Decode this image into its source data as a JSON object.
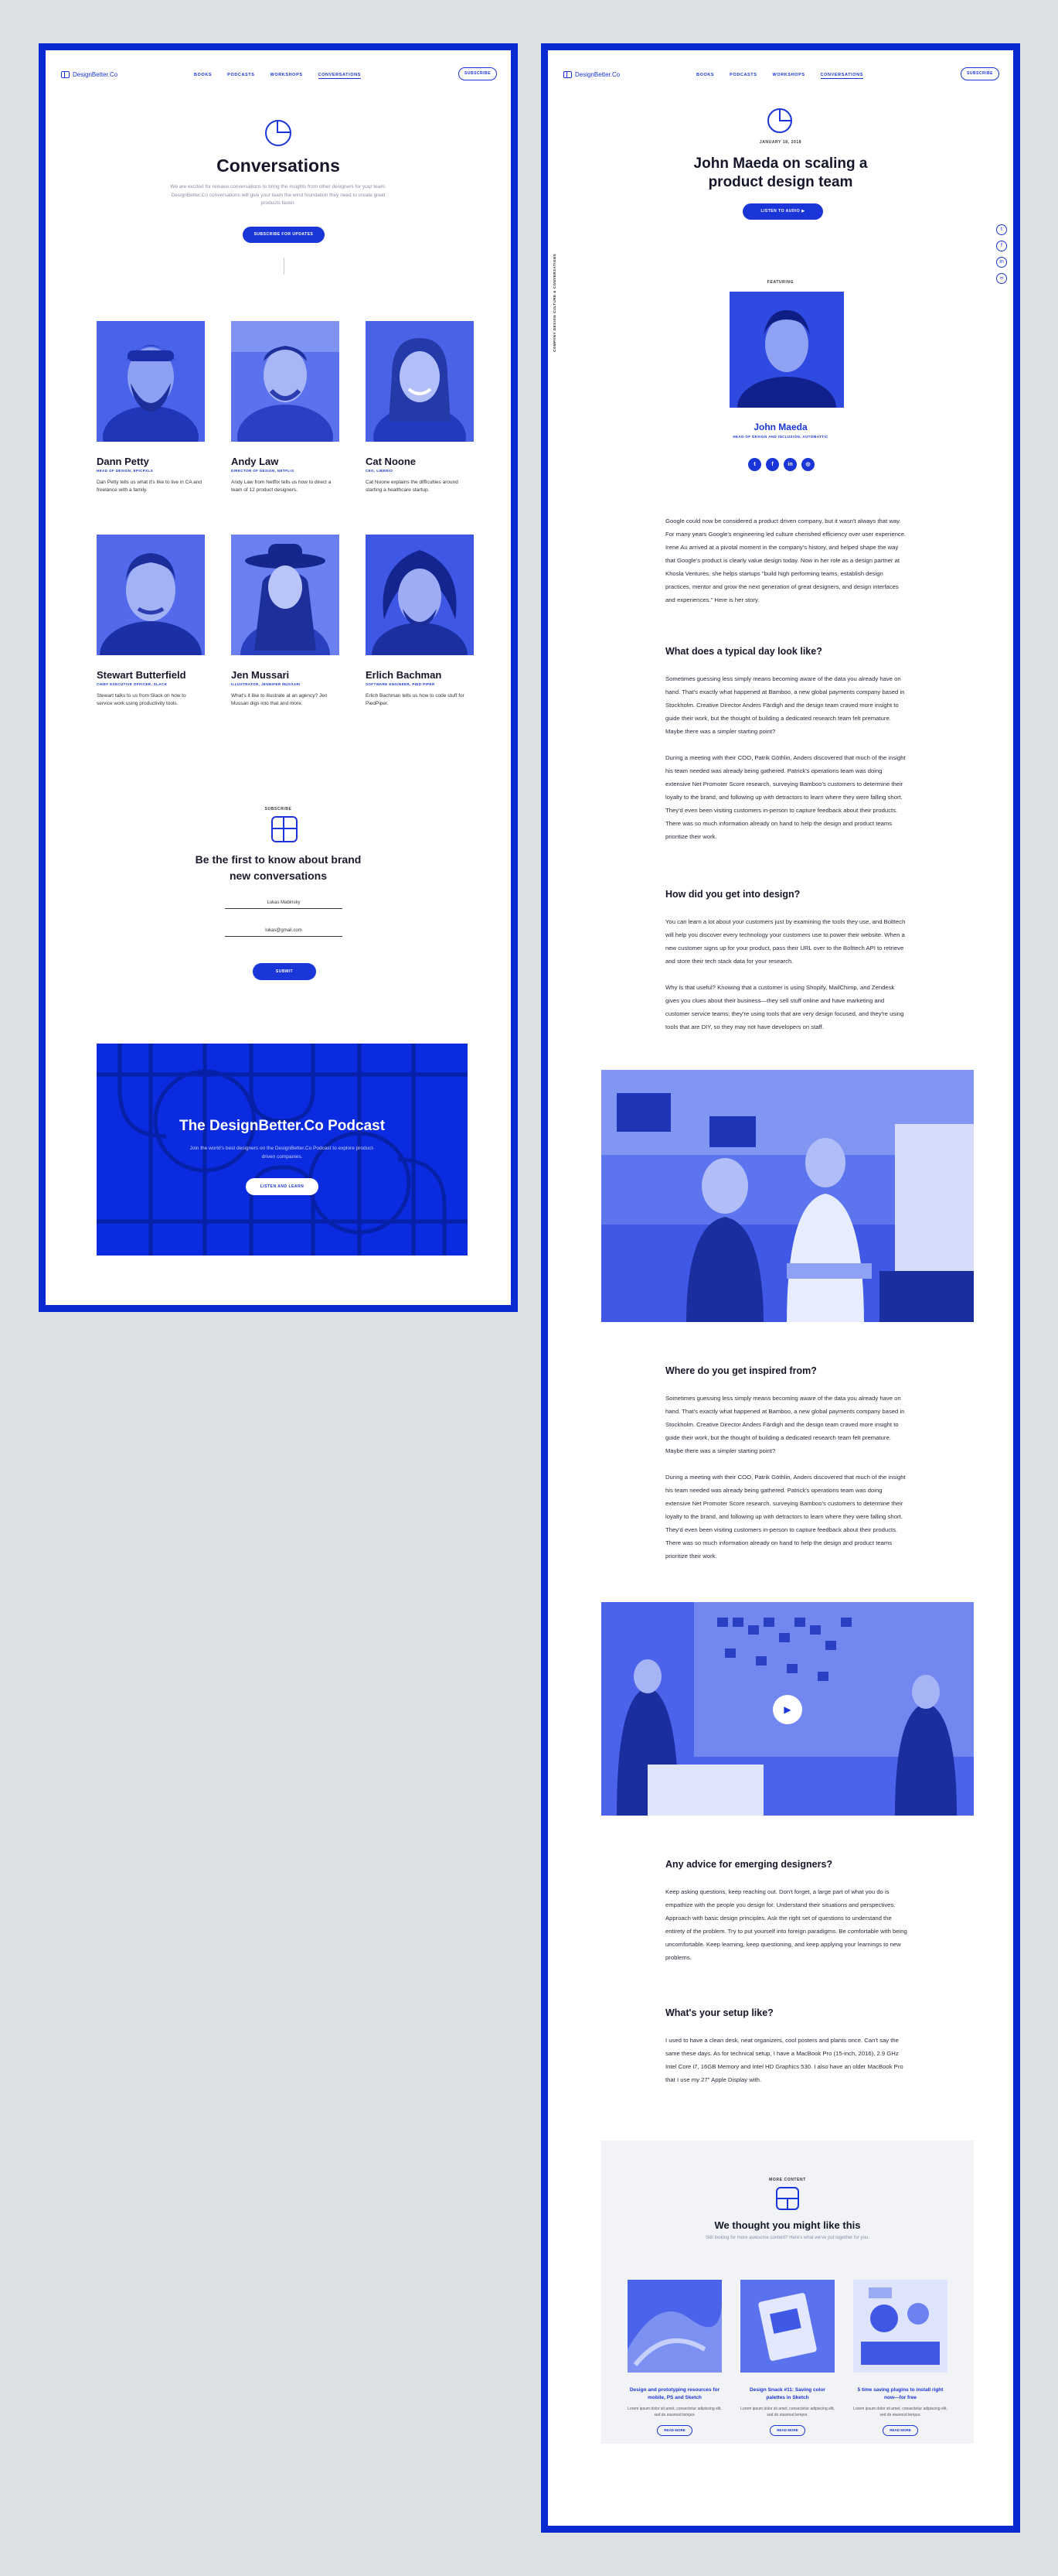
{
  "nav": {
    "logo": "DesignBetter.Co",
    "links": [
      "BOOKS",
      "PODCASTS",
      "WORKSHOPS",
      "CONVERSATIONS"
    ],
    "subscribe": "SUBSCRIBE"
  },
  "conversations": {
    "title": "Conversations",
    "intro": "We are excited for release conversations to bring the insights from other designers for your team. DesignBetter.Co conversations will give your team the wind foundation they need to create great products faster.",
    "cta": "SUBSCRIBE FOR UPDATES",
    "people": [
      {
        "name": "Dann Petty",
        "role": "HEAD OF DESIGN, EPICPXLS",
        "desc": "Dan Petty tells us what it's like to live in CA and freelance with a family."
      },
      {
        "name": "Andy Law",
        "role": "DIRECTOR OF DESIGN, NETFLIX",
        "desc": "Andy Law from Netflix tells us how to direct a team of 12 product designers."
      },
      {
        "name": "Cat Noone",
        "role": "CEO, LIBERIO",
        "desc": "Cat Noone explains the difficulties around starting a healthcare startup."
      },
      {
        "name": "Stewart Butterfield",
        "role": "CHIEF EXECUTIVE OFFICER, SLACK",
        "desc": "Stewart talks to us from Slack on how to service work using productivity tools."
      },
      {
        "name": "Jen Mussari",
        "role": "ILLUSTRATOR, JENNIFER MUSSARI",
        "desc": "What's it like to illustrate at an agency? Jen Mussari digs into that and more."
      },
      {
        "name": "Erlich Bachman",
        "role": "SOFTWARE ENGINEER, PIED PIPER",
        "desc": "Erlich Bachman tells us how to code stuff for PiedPiper."
      }
    ],
    "newsletter": {
      "label": "SUBSCRIBE",
      "title_line1": "Be the first to know about brand",
      "title_line2": "new conversations",
      "name_value": "Lukas Mabinsky",
      "email_value": "lukas@gmail.com",
      "submit": "SUBMIT"
    },
    "podcast": {
      "title": "The DesignBetter.Co Podcast",
      "desc": "Join the world's best designers on the DesignBetter.Co Podcast to explore product-driven companies.",
      "button": "LISTEN AND LEARN"
    }
  },
  "article": {
    "date": "JANUARY 18, 2018",
    "title_line1": "John Maeda on scaling a",
    "title_line2": "product design team",
    "listen": "LISTEN TO AUDIO",
    "side_label": "COMPANY DESIGN CULTURE & CONVERSATIONS",
    "featuring": "FEATURING",
    "guest_name": "John Maeda",
    "guest_role": "HEAD OF DESIGN AND INCLUSION, AUTOMATTIC",
    "intro": "Google could now be considered a product driven company, but it wasn't always that way. For many years Google's engineering led culture cherished efficiency over user experience. Irene Au arrived at a pivotal moment in the company's history, and helped shape the way that Google's product is clearly value design today. Now in her role as a design partner at Khosla Ventures, she helps startups \"build high performing teams, establish design practices, mentor and grow the next generation of great designers, and design interfaces and experiences.\" Here is her story.",
    "q1": "What does a typical day look like?",
    "a1a": "Sometimes guessing less simply means becoming aware of the data you already have on hand. That's exactly what happened at Bamboo, a new global payments company based in Stockholm. Creative Director Anders Färdigh and the design team craved more insight to guide their work, but the thought of building a dedicated research team felt premature. Maybe there was a simpler starting point?",
    "a1b": "During a meeting with their COO, Patrik Göthlin, Anders discovered that much of the insight his team needed was already being gathered. Patrick's operations team was doing extensive Net Promoter Score research, surveying Bamboo's customers to determine their loyalty to the brand, and following up with detractors to learn where they were falling short. They'd even been visiting customers in-person to capture feedback about their products. There was so much information already on hand to help the design and product teams prioritize their work.",
    "q2": "How did you get into design?",
    "a2a": "You can learn a lot about your customers just by examining the tools they use, and Bolttech will help you discover every technology your customers use to power their website. When a new customer signs up for your product, pass their URL over to the Bolttech API to retrieve and store their tech stack data for your research.",
    "a2b": "Why is that useful? Knowing that a customer is using Shopify, MailChimp, and Zendesk gives you clues about their business—they sell stuff online and have marketing and customer service teams; they're using tools that are very design focused, and they're using tools that are DIY, so they may not have developers on staff.",
    "q3": "Where do you get inspired from?",
    "a3a": "Sometimes guessing less simply means becoming aware of the data you already have on hand. That's exactly what happened at Bamboo, a new global payments company based in Stockholm. Creative Director Anders Färdigh and the design team craved more insight to guide their work, but the thought of building a dedicated research team felt premature. Maybe there was a simpler starting point?",
    "a3b": "During a meeting with their COO, Patrik Göthlin, Anders discovered that much of the insight his team needed was already being gathered. Patrick's operations team was doing extensive Net Promoter Score research, surveying Bamboo's customers to determine their loyalty to the brand, and following up with detractors to learn where they were falling short. They'd even been visiting customers in-person to capture feedback about their products. There was so much information already on hand to help the design and product teams prioritize their work.",
    "q4": "Any advice for emerging designers?",
    "a4": "Keep asking questions, keep reaching out. Don't forget, a large part of what you do is empathize with the people you design for. Understand their situations and perspectives. Approach with basic design principles. Ask the right set of questions to understand the entirety of the problem. Try to put yourself into foreign paradigms. Be comfortable with being uncomfortable. Keep learning, keep questioning, and keep applying your learnings to new problems.",
    "q5": "What's your setup like?",
    "a5": "I used to have a clean desk, neat organizers, cool posters and plants once. Can't say the same these days. As for technical setup, I have a MacBook Pro (15-inch, 2016), 2.9 GHz Intel Core i7, 16GB Memory and Intel HD Graphics 530. I also have an older MacBook Pro that I use my 27\" Apple Display with.",
    "related": {
      "label": "MORE CONTENT",
      "title": "We thought you might like this",
      "subtitle": "Still looking for more awesome content? Here's what we've put together for you.",
      "items": [
        {
          "title": "Design and prototyping resources for mobile, PS and Sketch",
          "desc": "Lorem ipsum dolor sit amet, consectetur adipiscing elit, sed do eiusmod tempor.",
          "button": "READ MORE"
        },
        {
          "title": "Design Snack #11: Saving color palettes in Sketch",
          "desc": "Lorem ipsum dolor sit amet, consectetur adipiscing elit, sed do eiusmod tempor.",
          "button": "READ MORE"
        },
        {
          "title": "5 time saving plugins to install right now—for free",
          "desc": "Lorem ipsum dolor sit amet, consectetur adipiscing elit, sed do eiusmod tempor.",
          "button": "READ MORE"
        }
      ]
    }
  },
  "colors": {
    "accent": "#1a35d8",
    "frame": "#0a2ad1",
    "background": "#dde0e3"
  }
}
